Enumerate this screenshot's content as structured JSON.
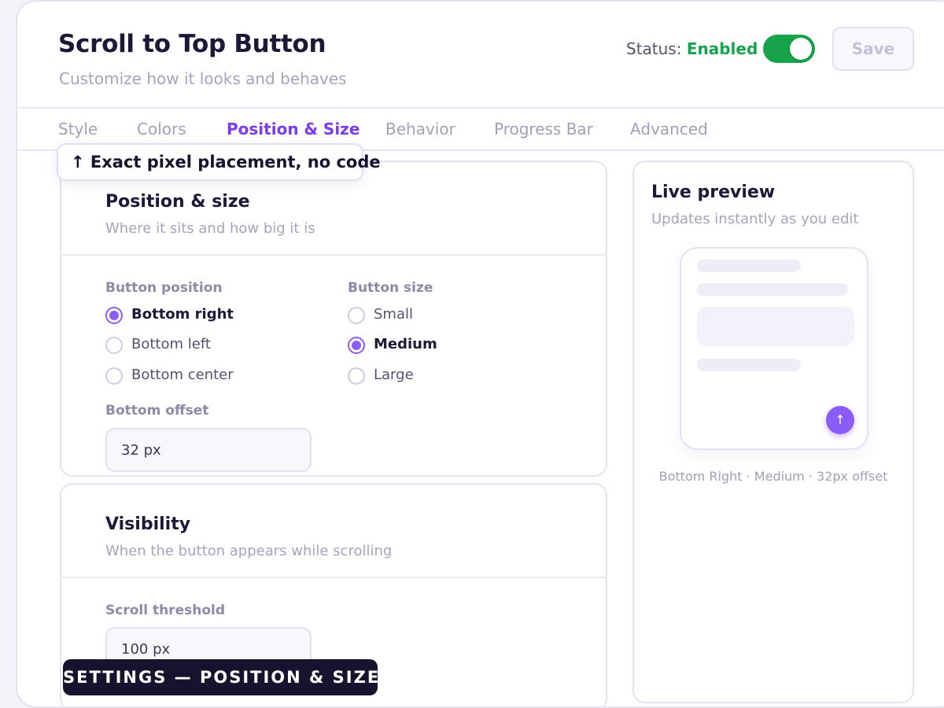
{
  "header": {
    "title": "Scroll to Top Button",
    "subtitle": "Customize how it looks and behaves",
    "status_label": "Status:",
    "status_value": "Enabled",
    "status_color": "#14a44d",
    "toggle_on": true,
    "save_label": "Save"
  },
  "tabs": [
    {
      "label": "Style",
      "active": false
    },
    {
      "label": "Colors",
      "active": false
    },
    {
      "label": "Position & Size",
      "active": true
    },
    {
      "label": "Behavior",
      "active": false
    },
    {
      "label": "Progress Bar",
      "active": false
    },
    {
      "label": "Advanced",
      "active": false
    }
  ],
  "callout": {
    "text": "↑ Exact pixel placement, no code"
  },
  "position_card": {
    "title": "Position & size",
    "description": "Where it sits and how big it is",
    "button_position": {
      "label": "Button position",
      "options": [
        "Bottom right",
        "Bottom left",
        "Bottom center"
      ],
      "selected": "Bottom right"
    },
    "button_size": {
      "label": "Button size",
      "options": [
        "Small",
        "Medium",
        "Large"
      ],
      "selected": "Medium"
    },
    "bottom_offset": {
      "label": "Bottom offset",
      "value": "32 px"
    }
  },
  "visibility_card": {
    "title": "Visibility",
    "description": "When the button appears while scrolling",
    "scroll_threshold": {
      "label": "Scroll threshold",
      "value": "100 px"
    }
  },
  "preview": {
    "title": "Live preview",
    "subtitle": "Updates instantly as you edit",
    "button_icon": "arrow-up-icon",
    "button_glyph": "↑",
    "caption": "Bottom Right · Medium · 32px offset",
    "accent_color": "#8b5cf6"
  },
  "badge": {
    "text": "SETTINGS — POSITION & SIZE"
  }
}
